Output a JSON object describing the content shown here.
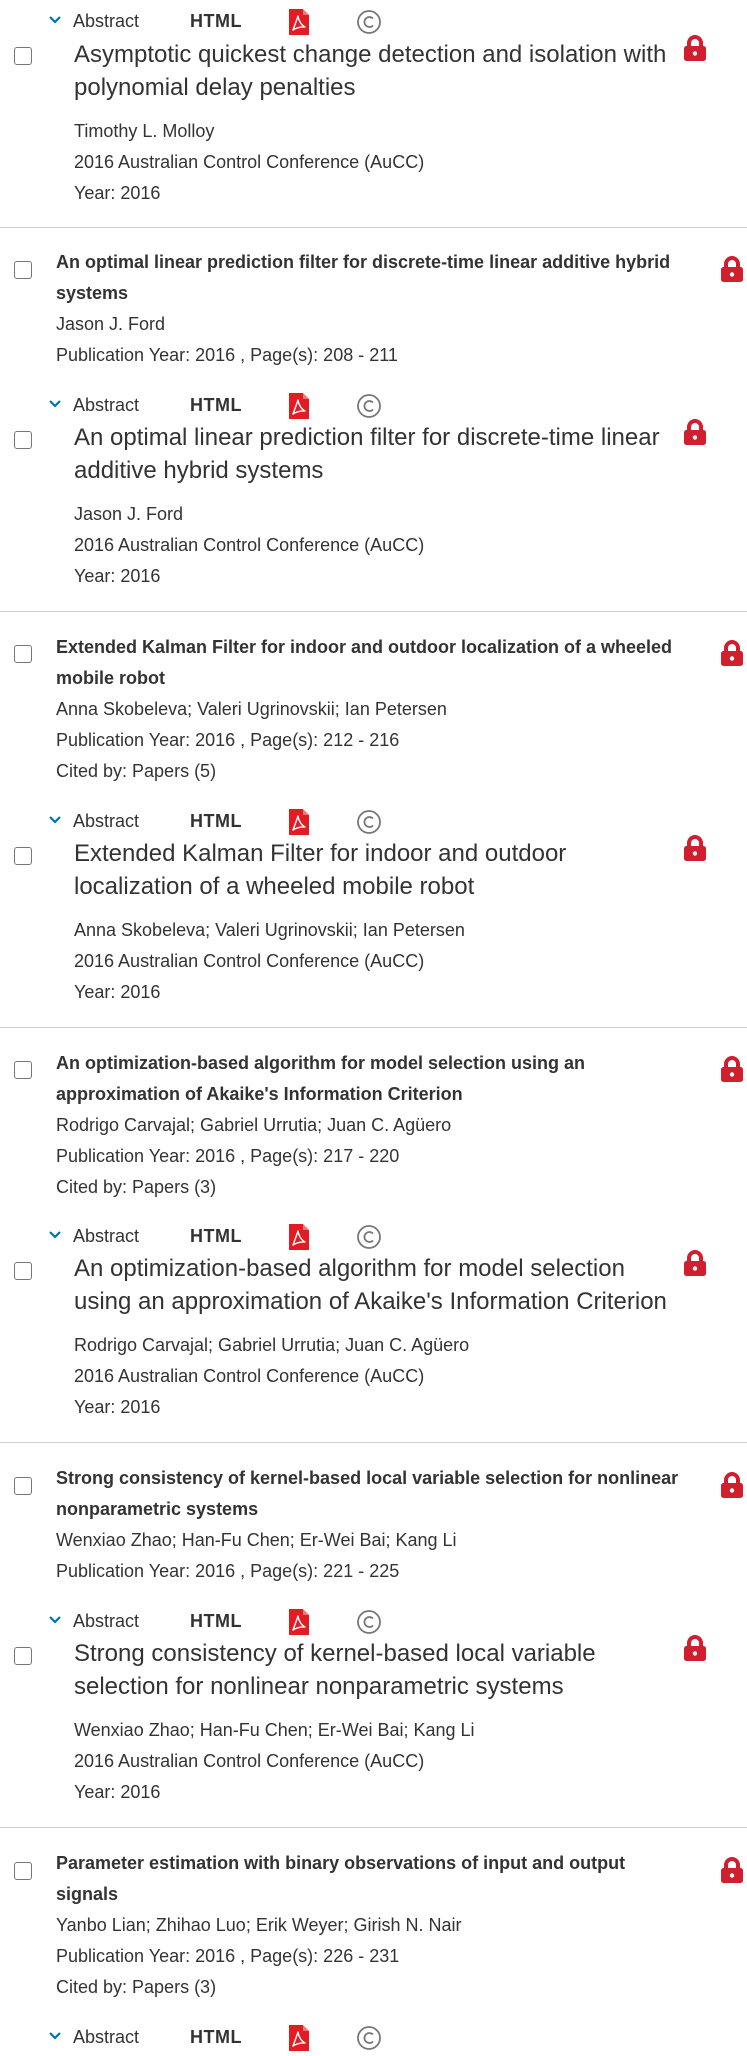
{
  "colors": {
    "accent": "#0073b0",
    "lock": "#d01f2e",
    "pdf": "#e31b23",
    "copyright": "#777777"
  },
  "icons": {
    "chevron": "chevron-down-icon",
    "pdf": "pdf-icon",
    "copyright": "copyright-icon",
    "lock": "lock-icon",
    "checkbox": "checkbox-icon"
  },
  "labels": {
    "abstract": "Abstract",
    "html": "HTML"
  },
  "top_partial": {
    "expanded": {
      "title": "Asymptotic quickest change detection and isolation with polynomial delay penalties",
      "authors": "Timothy L. Molloy",
      "conference": "2016 Australian Control Conference (AuCC)",
      "year": "Year: 2016"
    }
  },
  "results": [
    {
      "title": "An optimal linear prediction filter for discrete-time linear additive hybrid systems",
      "authors": "Jason J. Ford",
      "pub_info": "Publication Year: 2016 , Page(s): 208  -  211",
      "cited": "",
      "expanded": {
        "title": "An optimal linear prediction filter for discrete-time linear additive hybrid systems",
        "authors": "Jason J. Ford",
        "conference": "2016 Australian Control Conference (AuCC)",
        "year": "Year: 2016"
      }
    },
    {
      "title": "Extended Kalman Filter for indoor and outdoor localization of a wheeled mobile robot",
      "authors": "Anna Skobeleva; Valeri Ugrinovskii; Ian Petersen",
      "pub_info": "Publication Year: 2016 , Page(s): 212  -  216",
      "cited": "Cited by: Papers (5)",
      "expanded": {
        "title": "Extended Kalman Filter for indoor and outdoor localization of a wheeled mobile robot",
        "authors": "Anna Skobeleva; Valeri Ugrinovskii; Ian Petersen",
        "conference": "2016 Australian Control Conference (AuCC)",
        "year": "Year: 2016"
      }
    },
    {
      "title": "An optimization-based algorithm for model selection using an approximation of Akaike's Information Criterion",
      "authors": "Rodrigo Carvajal; Gabriel Urrutia; Juan C. Agüero",
      "pub_info": "Publication Year: 2016 , Page(s): 217  -  220",
      "cited": "Cited by: Papers (3)",
      "expanded": {
        "title": "An optimization-based algorithm for model selection using an approximation of Akaike's Information Criterion",
        "authors": "Rodrigo Carvajal; Gabriel Urrutia; Juan C. Agüero",
        "conference": "2016 Australian Control Conference (AuCC)",
        "year": "Year: 2016"
      }
    },
    {
      "title": "Strong consistency of kernel-based local variable selection for nonlinear nonparametric systems",
      "authors": "Wenxiao Zhao; Han-Fu Chen; Er-Wei Bai; Kang Li",
      "pub_info": "Publication Year: 2016 , Page(s): 221  -  225",
      "cited": "",
      "expanded": {
        "title": "Strong consistency of kernel-based local variable selection for nonlinear nonparametric systems",
        "authors": "Wenxiao Zhao; Han-Fu Chen; Er-Wei Bai; Kang Li",
        "conference": "2016 Australian Control Conference (AuCC)",
        "year": "Year: 2016"
      }
    },
    {
      "title": "Parameter estimation with binary observations of input and output signals",
      "authors": "Yanbo Lian; Zhihao Luo; Erik Weyer; Girish N. Nair",
      "pub_info": "Publication Year: 2016 , Page(s): 226  -  231",
      "cited": "Cited by: Papers (3)"
    }
  ]
}
